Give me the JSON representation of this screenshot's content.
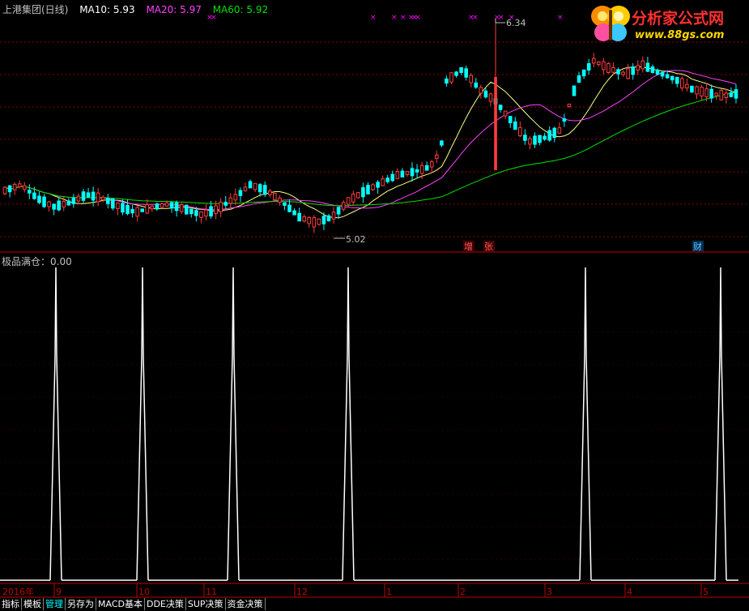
{
  "header": {
    "title": "上港集团(日线)",
    "ma10_label": "MA10: 5.93",
    "ma20_label": "MA20: 5.97",
    "ma60_label": "MA60: 5.92"
  },
  "sub_indicator": {
    "title": "极品满仓：0.00"
  },
  "logo": {
    "text": "分析家公式网",
    "url": "www.88gs.com",
    "icon": "butterfly-icon"
  },
  "price_annotations": {
    "high": "6.34",
    "low": "5.02"
  },
  "event_markers": [
    "增",
    "张",
    "财"
  ],
  "time_axis": {
    "year_label": "2016年",
    "month_labels": [
      "9",
      "10",
      "11",
      "12",
      "1",
      "2",
      "3",
      "4",
      "5"
    ]
  },
  "tabs": [
    {
      "label": "指标",
      "active": false
    },
    {
      "label": "模板",
      "active": false
    },
    {
      "label": "管理",
      "active": true
    },
    {
      "label": "另存为",
      "active": false
    },
    {
      "label": "MACD基本",
      "active": false
    },
    {
      "label": "DDE决策",
      "active": false
    },
    {
      "label": "SUP决策",
      "active": false
    },
    {
      "label": "资金决策",
      "active": false
    }
  ],
  "colors": {
    "up": "#ff3c3c",
    "down": "#00ffff",
    "ma10": "#ffff80",
    "ma20": "#ff40ff",
    "ma60": "#00e000",
    "grid": "#8b0000",
    "axis": "#c00000",
    "spike": "#ffffff",
    "cross": "#ff00ff",
    "title": "#c0c0c0"
  },
  "chart_data": [
    {
      "type": "candlestick",
      "title": "上港集团(日线)",
      "ylim": [
        4.9,
        6.45
      ],
      "annotations": [
        {
          "label": "6.34",
          "value": 6.34
        },
        {
          "label": "5.02",
          "value": 5.02
        }
      ],
      "series": [
        {
          "name": "MA10"
        },
        {
          "name": "MA20"
        },
        {
          "name": "MA60"
        }
      ],
      "x_labels": [
        "2016年",
        "9",
        "10",
        "11",
        "12",
        "1",
        "2",
        "3",
        "4",
        "5"
      ]
    },
    {
      "type": "line",
      "title": "极品满仓",
      "value_label": "0.00",
      "series": [
        {
          "name": "极品满仓",
          "spike_months_index": [
            0,
            1,
            2,
            3,
            6,
            8
          ],
          "values_at_spikes": [
            1,
            1,
            1,
            1,
            1,
            1
          ]
        }
      ]
    }
  ]
}
